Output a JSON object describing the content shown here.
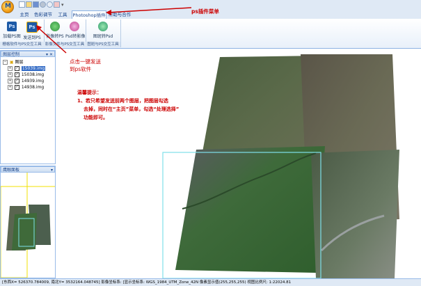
{
  "quick_access": {
    "icons": [
      "new-icon",
      "open-icon",
      "save-icon",
      "settings-icon",
      "undo-icon",
      "close-icon"
    ]
  },
  "tabs": [
    "主页",
    "色彩调节",
    "工具",
    "Photoshop插件",
    "帮助与合作"
  ],
  "active_tab": "Photoshop插件",
  "ribbon": {
    "groups": [
      {
        "label": "栅格软件与PS交互工具",
        "buttons": [
          "加载PS图",
          "发送到PS"
        ]
      },
      {
        "label": "影像文件与PS交互工具",
        "buttons": [
          "影像转PS",
          "Psd转影像"
        ]
      },
      {
        "label": "图斑与PS交互工具",
        "buttons": [
          "图斑转Psd"
        ]
      }
    ]
  },
  "layer_panel": {
    "title": "图层控制",
    "root": "图层",
    "layers": [
      "15039.img",
      "15038.img",
      "14939.img",
      "14938.img"
    ],
    "selected": "15039.img"
  },
  "eagle_panel": {
    "title": "鹰眼面板"
  },
  "annotations": {
    "ps_menu": "ps插件菜单",
    "send_line1": "点击一键发送",
    "send_line2": "到ps软件",
    "tip_title": "温馨提示：",
    "tip_line1": "1、若只希望发送前两个图层，把图层勾选",
    "tip_line2": "去掉，同时在“主页”菜单，勾选“处理选择”",
    "tip_line3": "功能即可。"
  },
  "colors": {
    "annotation_red": "#cc0000",
    "selection_box": "#7ee0ea",
    "ribbon_border": "#8db2e3"
  },
  "statusbar": {
    "text": "[东西X= 526370.784009, 南北Y= 3532164.048745] 影像坐标系: [显示坐标系: WGS_1984_UTM_Zone_42N 像素显示值(255,255,255)  视图比例尺: 1:22024.81"
  }
}
